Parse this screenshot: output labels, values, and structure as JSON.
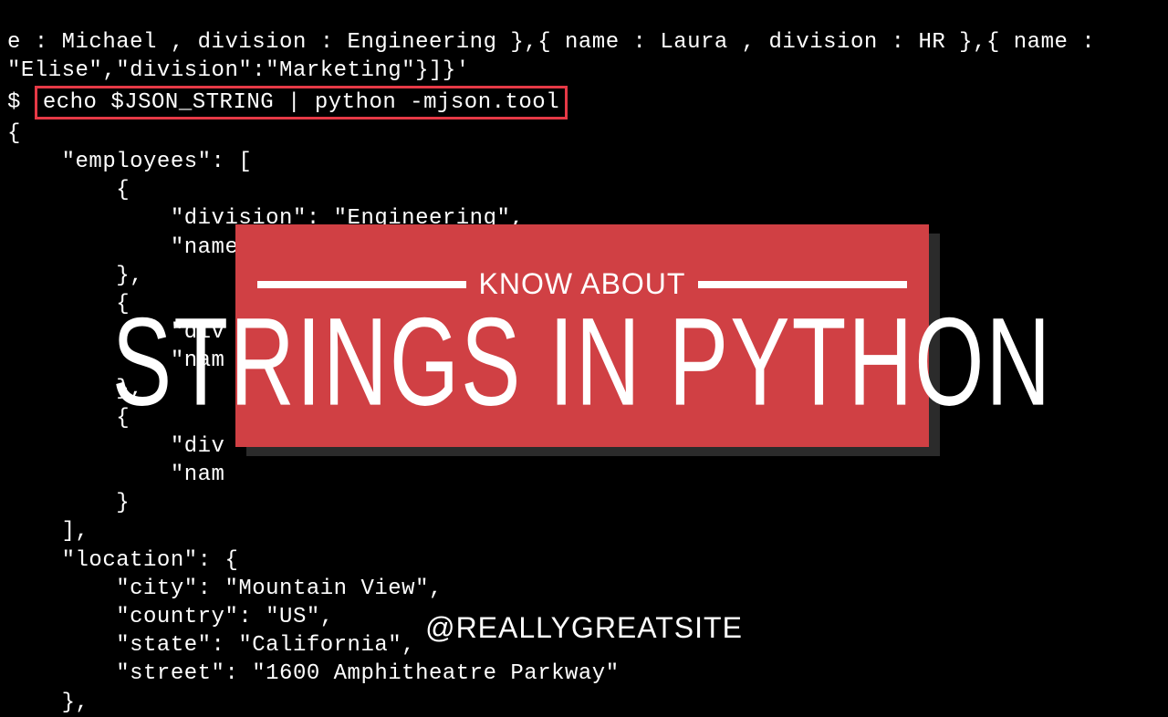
{
  "terminal": {
    "line_top_frag": "e : Michael , division : Engineering },{ name : Laura , division : HR },{ name :",
    "line_elise": "\"Elise\",\"division\":\"Marketing\"}]}'",
    "prompt": "$ ",
    "command": "echo $JSON_STRING | python -mjson.tool",
    "json_output": "{\n    \"employees\": [\n        {\n            \"division\": \"Engineering\",\n            \"name\": \"Michael\"\n        },\n        {\n            \"div\n            \"nam\n        },\n        {\n            \"div\n            \"nam\n        }\n    ],\n    \"location\": {\n        \"city\": \"Mountain View\",\n        \"country\": \"US\",\n        \"state\": \"California\",\n        \"street\": \"1600 Amphitheatre Parkway\"\n    },"
  },
  "banner": {
    "kicker": "KNOW ABOUT",
    "headline": "STRINGS IN PYTHON"
  },
  "handle": "@REALLYGREATSITE",
  "colors": {
    "highlight_border": "#e63946",
    "banner_bg": "#d04044"
  }
}
